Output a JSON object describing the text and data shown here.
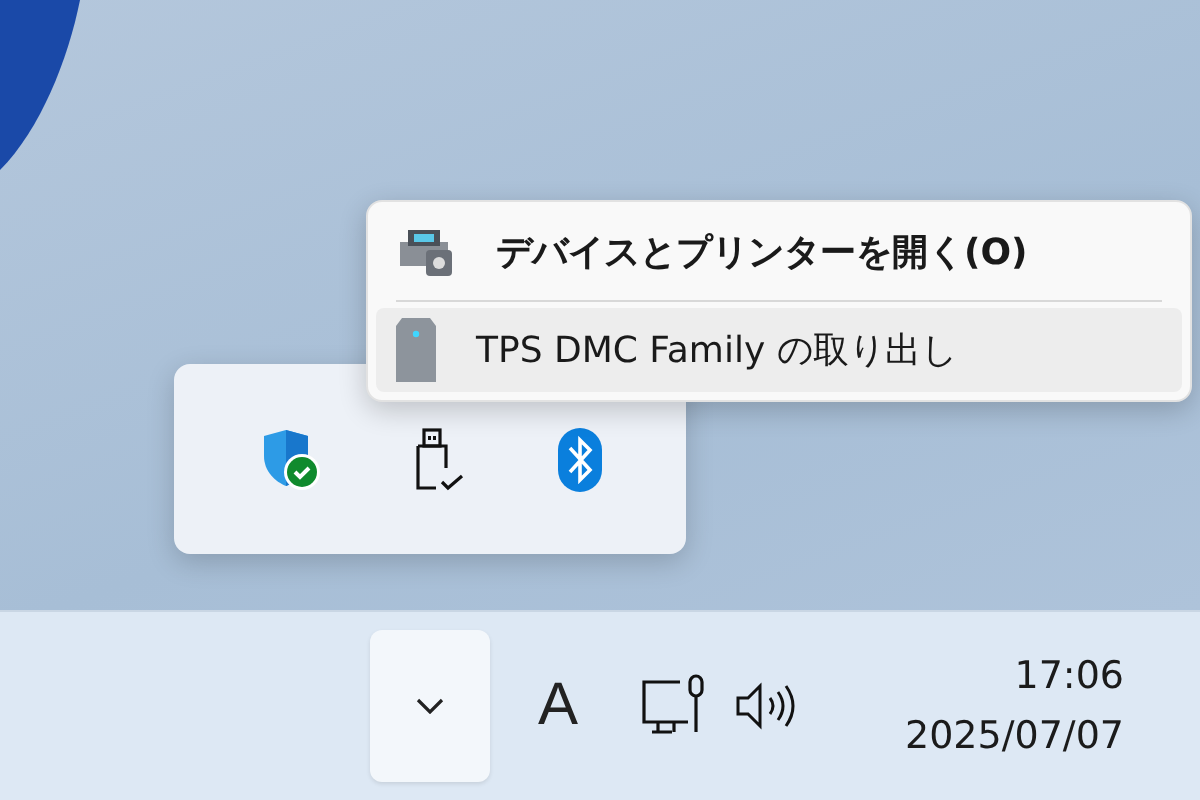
{
  "context_menu": {
    "items": [
      {
        "label": "デバイスとプリンターを開く(O)",
        "kind": "printer",
        "default": true,
        "selected": false
      },
      {
        "label": "TPS DMC Family の取り出し",
        "kind": "drive",
        "default": false,
        "selected": true
      }
    ]
  },
  "tray_flyout": {
    "icons": [
      {
        "kind": "shield"
      },
      {
        "kind": "usb"
      },
      {
        "kind": "bluetooth"
      }
    ]
  },
  "taskbar": {
    "overflow_button": {
      "expanded": true
    },
    "ime_indicator": "A",
    "clock": {
      "time": "17:06",
      "date": "2025/07/07"
    }
  }
}
